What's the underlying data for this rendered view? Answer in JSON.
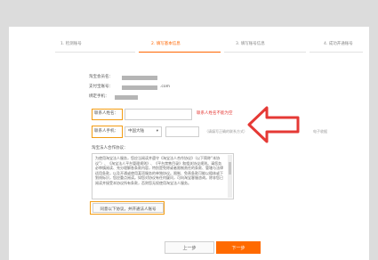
{
  "steps": [
    {
      "label": "1. 检测账号",
      "active": false
    },
    {
      "label": "2. 填写基本信息",
      "active": true
    },
    {
      "label": "3. 填写账号信息",
      "active": false
    },
    {
      "label": "4. 成功开通账号",
      "active": false
    }
  ],
  "account_info": {
    "login_name_label": "淘宝会员名：",
    "alipay_label": "支付宝账号：",
    "alipay_domain": ".com",
    "bind_phone_label": "绑定手机："
  },
  "form": {
    "contact_name_label": "联系人姓名：",
    "contact_name_value": "",
    "contact_name_error": "联系人姓名不能为空",
    "contact_phone_label": "联系人手机：",
    "phone_region": "中国大陆",
    "phone_region_caret": "▾",
    "contact_phone_hint": "（请填写正确的联系方式）",
    "contact_phone_hint_right": "电子收据"
  },
  "agreement": {
    "title": "淘宝法人合作协议：",
    "text": "为使用淘宝法人服务，您应当阅读并遵守《淘宝法人合作协议》（以下简称“本协议”）、《淘宝法人平台管理规则》、《平台禁售目录》和相关协议规则。请您务必审慎阅读、充分理解各条款内容，特别是免除或者限制责任的条款、管辖与法律适用条款，以及开通或使用某项服务的单独协议。限制、免责条款可能以粗体或下划线标识，您应重点阅读。如您对协议有任何疑问，可向淘宝客服咨询。除非您已阅读并接受本协议所有条款，否则您无权使用淘宝法人服务。"
  },
  "buttons": {
    "agree": "同意以下协议，并开通法人账号",
    "prev": "上一步",
    "next": "下一步"
  },
  "colors": {
    "accent": "#ff6600",
    "highlight": "#f39c12",
    "error": "#e53935",
    "annotation_arrow": "#e53935"
  },
  "icons": {
    "annotation": "red-arrow-icon",
    "dropdown": "chevron-down-icon"
  }
}
